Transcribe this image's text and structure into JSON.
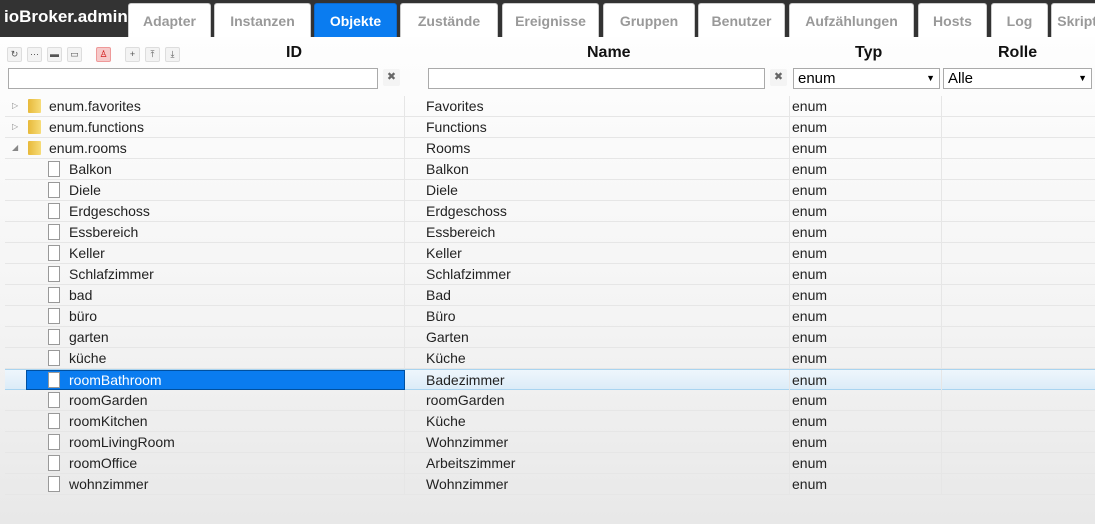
{
  "app_title": "ioBroker.admin",
  "tabs": [
    {
      "label": "Adapter",
      "active": false
    },
    {
      "label": "Instanzen",
      "active": false
    },
    {
      "label": "Objekte",
      "active": true
    },
    {
      "label": "Zustände",
      "active": false
    },
    {
      "label": "Ereignisse",
      "active": false
    },
    {
      "label": "Gruppen",
      "active": false
    },
    {
      "label": "Benutzer",
      "active": false
    },
    {
      "label": "Aufzählungen",
      "active": false
    },
    {
      "label": "Hosts",
      "active": false
    },
    {
      "label": "Log",
      "active": false
    },
    {
      "label": "Skripte",
      "active": false
    }
  ],
  "toolbar": {
    "icons": [
      "refresh-icon",
      "list-icon",
      "folder-closed-icon",
      "folder-open-icon",
      "user-icon",
      "add-icon",
      "upload-icon",
      "download-icon"
    ]
  },
  "columns": {
    "id": "ID",
    "name": "Name",
    "typ": "Typ",
    "rolle": "Rolle"
  },
  "filters": {
    "id": "",
    "name": "",
    "typ": "enum",
    "rolle": "Alle",
    "clear": "✖"
  },
  "accent": "#0a7cf0",
  "rows": [
    {
      "id": "enum.favorites",
      "name": "Favorites",
      "typ": "enum",
      "level": 0,
      "state": "collapsed"
    },
    {
      "id": "enum.functions",
      "name": "Functions",
      "typ": "enum",
      "level": 0,
      "state": "collapsed"
    },
    {
      "id": "enum.rooms",
      "name": "Rooms",
      "typ": "enum",
      "level": 0,
      "state": "expanded"
    },
    {
      "id": "Balkon",
      "name": "Balkon",
      "typ": "enum",
      "level": 1
    },
    {
      "id": "Diele",
      "name": "Diele",
      "typ": "enum",
      "level": 1
    },
    {
      "id": "Erdgeschoss",
      "name": "Erdgeschoss",
      "typ": "enum",
      "level": 1
    },
    {
      "id": "Essbereich",
      "name": "Essbereich",
      "typ": "enum",
      "level": 1
    },
    {
      "id": "Keller",
      "name": "Keller",
      "typ": "enum",
      "level": 1
    },
    {
      "id": "Schlafzimmer",
      "name": "Schlafzimmer",
      "typ": "enum",
      "level": 1
    },
    {
      "id": "bad",
      "name": "Bad",
      "typ": "enum",
      "level": 1
    },
    {
      "id": "büro",
      "name": "Büro",
      "typ": "enum",
      "level": 1
    },
    {
      "id": "garten",
      "name": "Garten",
      "typ": "enum",
      "level": 1
    },
    {
      "id": "küche",
      "name": "Küche",
      "typ": "enum",
      "level": 1
    },
    {
      "id": "roomBathroom",
      "name": "Badezimmer",
      "typ": "enum",
      "level": 1,
      "selected": true
    },
    {
      "id": "roomGarden",
      "name": "roomGarden",
      "typ": "enum",
      "level": 1
    },
    {
      "id": "roomKitchen",
      "name": "Küche",
      "typ": "enum",
      "level": 1
    },
    {
      "id": "roomLivingRoom",
      "name": "Wohnzimmer",
      "typ": "enum",
      "level": 1
    },
    {
      "id": "roomOffice",
      "name": "Arbeitszimmer",
      "typ": "enum",
      "level": 1
    },
    {
      "id": "wohnzimmer",
      "name": "Wohnzimmer",
      "typ": "enum",
      "level": 1
    }
  ]
}
